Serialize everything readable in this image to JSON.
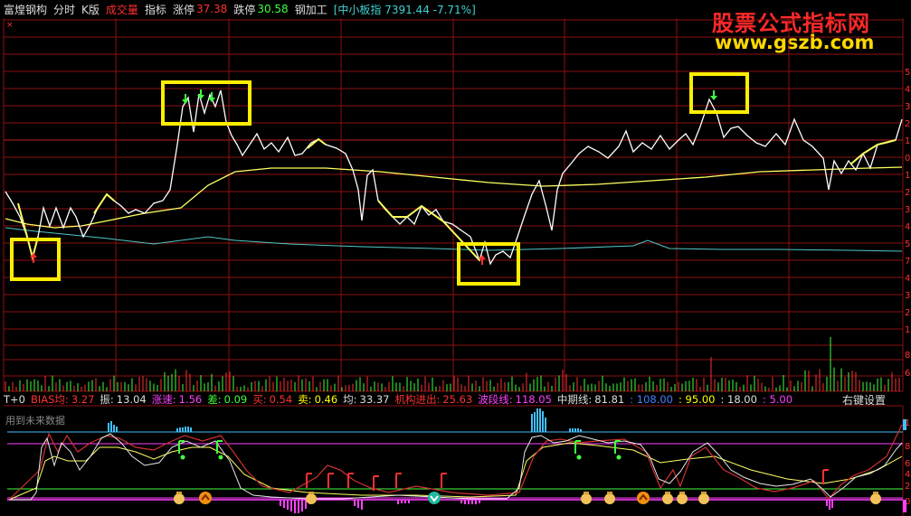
{
  "header": {
    "stock_name": "富煌钢构",
    "tabs": [
      "分时",
      "K版",
      "成交量",
      "指标"
    ],
    "limit_up_label": "涨停",
    "limit_up_value": "37.38",
    "limit_down_label": "跌停",
    "limit_down_value": "30.58",
    "sector": "钢加工",
    "index_info": "[中小板指 7391.44 -7.71%]"
  },
  "watermark": {
    "line1": "股票公式指标网",
    "line2": "www.gszb.com"
  },
  "indicator_bar": {
    "mode": "T+0",
    "items": [
      {
        "label": "BIAS均:",
        "value": "3.27",
        "color": "#ff3030"
      },
      {
        "label": "振:",
        "value": "13.04",
        "color": "#dddddd"
      },
      {
        "label": "涨速:",
        "value": "1.56",
        "color": "#ff40ff"
      },
      {
        "label": "差:",
        "value": "0.09",
        "color": "#40ff40"
      },
      {
        "label": "买:",
        "value": "0.54",
        "color": "#ff3030"
      },
      {
        "label": "卖:",
        "value": "0.46",
        "color": "#ffff00"
      },
      {
        "label": "均:",
        "value": "33.37",
        "color": "#dddddd"
      },
      {
        "label": "机构进出:",
        "value": "25.63",
        "color": "#ff3030"
      },
      {
        "label": "波段线:",
        "value": "118.05",
        "color": "#ff40ff"
      },
      {
        "label": "中期线:",
        "value": "81.81",
        "color": "#dddddd"
      }
    ],
    "extra_values": [
      ": 108.00",
      ": 95.00",
      ": 18.00",
      ": 5.00"
    ],
    "right_settings": "右键设置"
  },
  "note_future_data": "用到未来数据",
  "right_scale_top": [
    "5",
    "4",
    "3",
    "2",
    "1",
    "0",
    "1",
    "2",
    "3",
    "4",
    "5",
    "7",
    "4",
    "3",
    "2",
    "1"
  ],
  "right_scale_vol": [
    "8",
    "6"
  ],
  "right_scale_ind": [
    "1",
    "8",
    "6",
    "4",
    "2",
    "0"
  ],
  "colors": {
    "grid": "#8b1010",
    "price": "#ffffff",
    "avg": "#ffff60",
    "ref": "#50c8c8",
    "box": "#ffee00"
  }
}
